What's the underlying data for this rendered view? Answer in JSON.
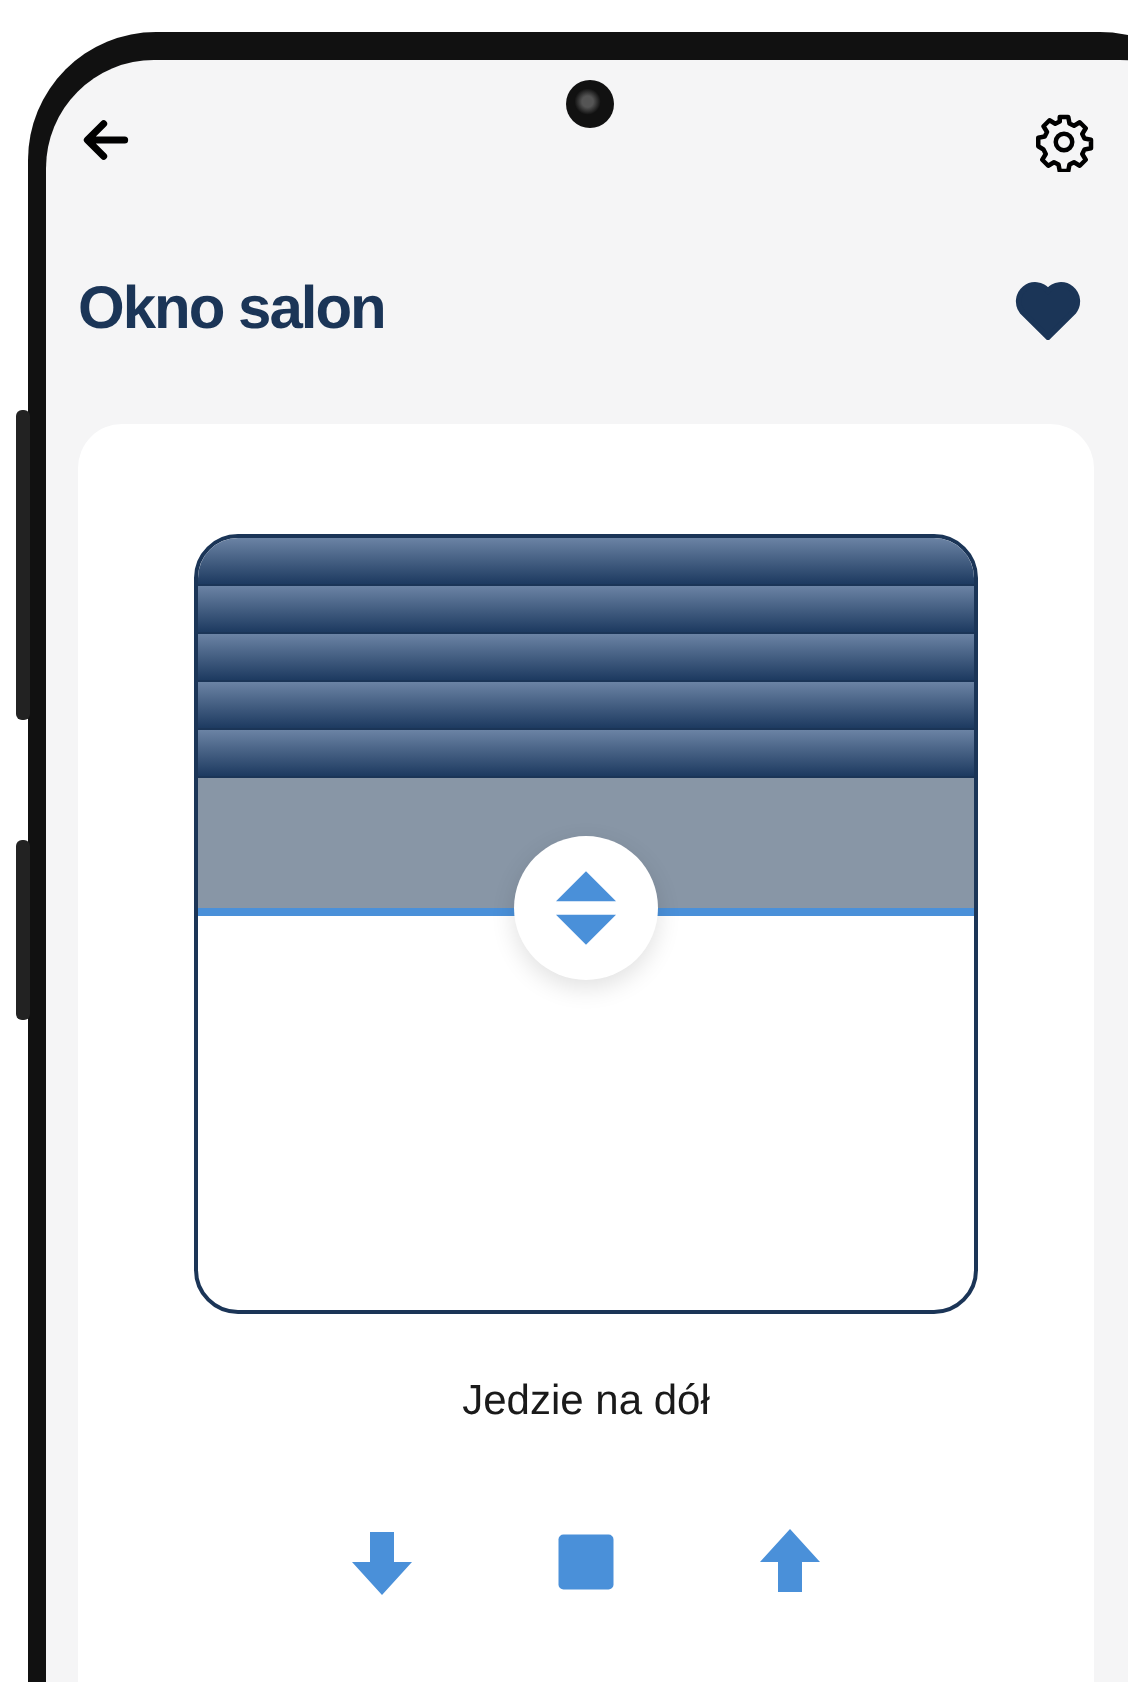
{
  "header": {
    "title": "Okno salon",
    "favorite": true
  },
  "blind": {
    "level": 0.48
  },
  "status": "Jedzie na dół",
  "controls": [
    {
      "kind": "down"
    },
    {
      "kind": "stop"
    },
    {
      "kind": "up"
    }
  ]
}
